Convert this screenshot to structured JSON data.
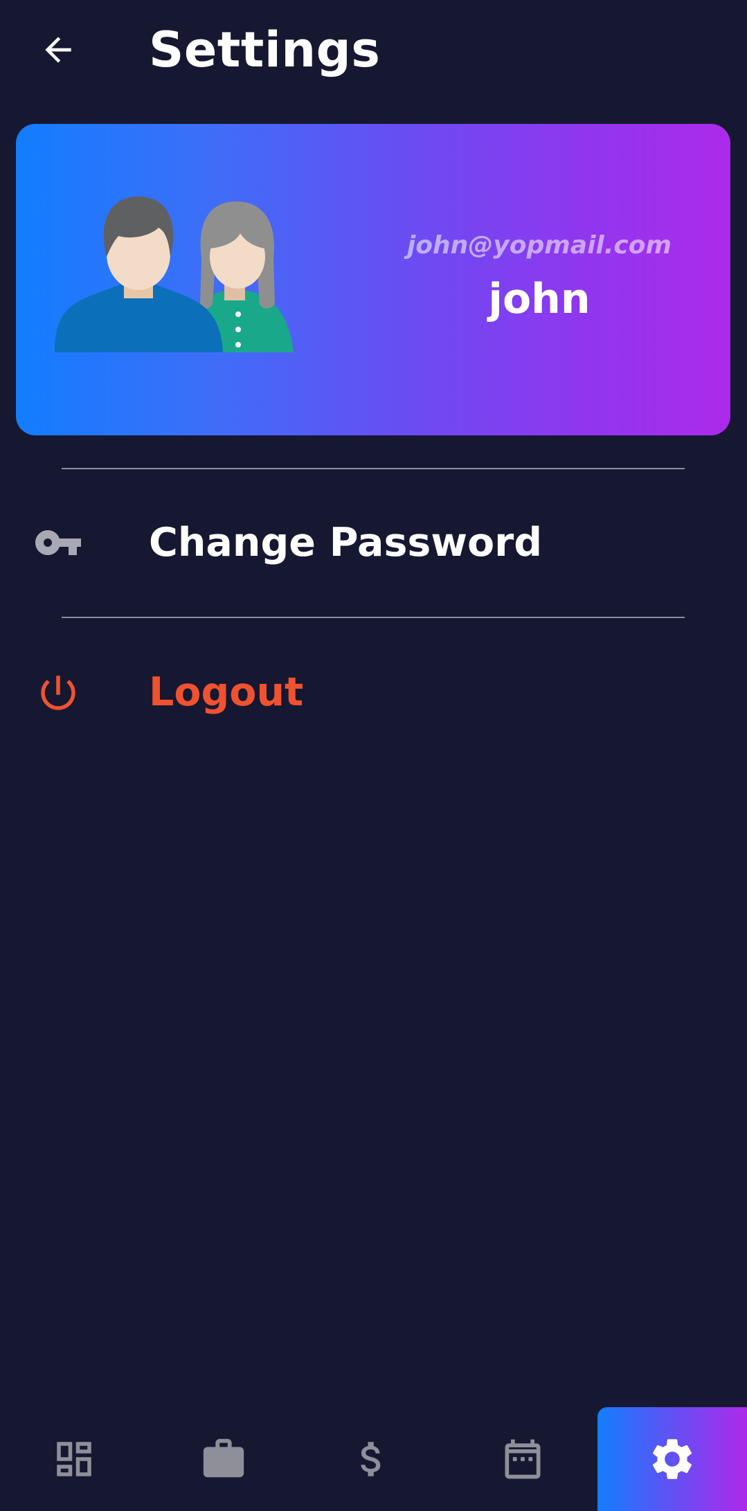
{
  "header": {
    "title": "Settings",
    "back_icon": "arrow-back-icon"
  },
  "profile": {
    "email": "john@yopmail.com",
    "name": "john",
    "avatar": "couple-avatar-illustration"
  },
  "menu": {
    "change_password": {
      "label": "Change Password",
      "icon": "key-icon"
    },
    "logout": {
      "label": "Logout",
      "icon": "power-icon"
    }
  },
  "bottom_nav": {
    "items": [
      {
        "id": "dashboard",
        "icon": "dashboard-icon",
        "active": false
      },
      {
        "id": "jobs",
        "icon": "briefcase-icon",
        "active": false
      },
      {
        "id": "payments",
        "icon": "dollar-icon",
        "active": false
      },
      {
        "id": "calendar",
        "icon": "calendar-icon",
        "active": false
      },
      {
        "id": "settings",
        "icon": "gear-icon",
        "active": true
      }
    ]
  },
  "colors": {
    "background": "#161832",
    "gradient_start": "#137dfe",
    "gradient_end": "#ad2aeb",
    "logout": "#f0522f",
    "icon_muted": "#8e8f99",
    "divider": "#8a8b9c"
  }
}
